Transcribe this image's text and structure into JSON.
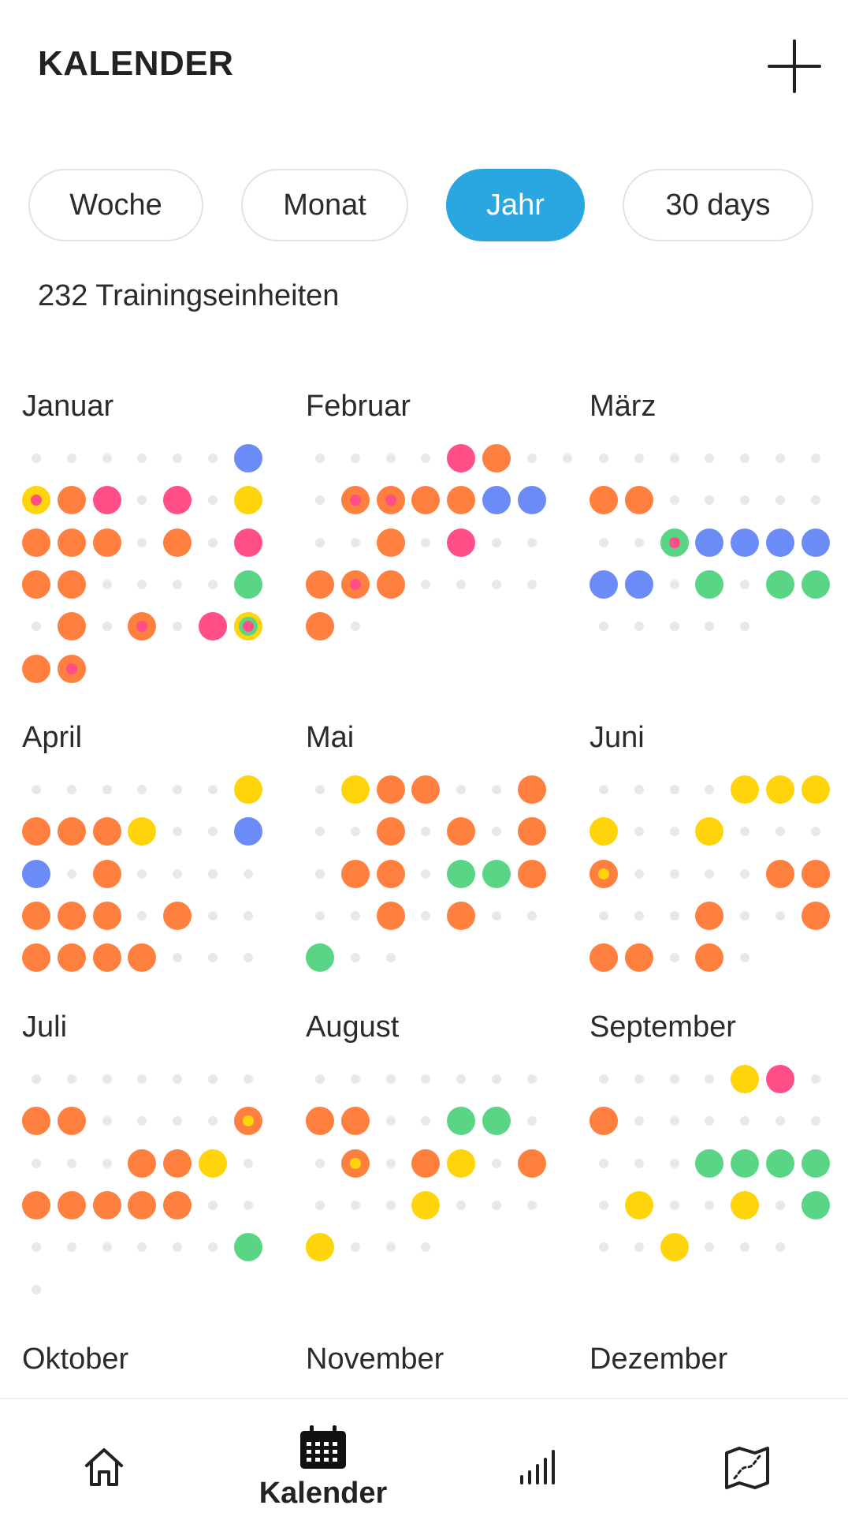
{
  "header": {
    "title": "KALENDER",
    "add_icon": "plus-icon"
  },
  "tabs": [
    {
      "label": "Woche",
      "active": false
    },
    {
      "label": "Monat",
      "active": false
    },
    {
      "label": "Jahr",
      "active": true
    },
    {
      "label": "30 days",
      "active": false
    }
  ],
  "summary": {
    "count_text": "232 Trainingseinheiten"
  },
  "colors": {
    "orange": "#ff7f3f",
    "pink": "#ff4f86",
    "yellow": "#ffd40a",
    "blue": "#6b8cf7",
    "green": "#5ad585",
    "empty": "#e8e8e8",
    "accent": "#2aa6e0"
  },
  "months": [
    {
      "name": "Januar",
      "weeks": [
        [
          ".",
          ".",
          ".",
          ".",
          ".",
          ".",
          "B"
        ],
        [
          "Y/P",
          "O",
          "P",
          ".",
          "P",
          ".",
          "Y"
        ],
        [
          "O",
          "O",
          "O",
          ".",
          "O",
          ".",
          "P"
        ],
        [
          "O",
          "O",
          ".",
          ".",
          ".",
          ".",
          "G"
        ],
        [
          ".",
          "O",
          ".",
          "O/P",
          ".",
          "P",
          "Y/G/P"
        ],
        [
          "O",
          "O/P"
        ]
      ]
    },
    {
      "name": "Februar",
      "weeks": [
        [
          ".",
          ".",
          ".",
          ".",
          "P",
          "O",
          ".",
          "."
        ],
        [
          ".",
          "O/P",
          "O/P",
          "O",
          "O",
          "B",
          "B"
        ],
        [
          ".",
          ".",
          "O",
          ".",
          "P",
          ".",
          "."
        ],
        [
          "O",
          "O/P",
          "O",
          ".",
          ".",
          ".",
          "."
        ],
        [
          "O",
          "."
        ]
      ]
    },
    {
      "name": "März",
      "weeks": [
        [
          ".",
          ".",
          ".",
          ".",
          ".",
          ".",
          "."
        ],
        [
          "O",
          "O",
          ".",
          ".",
          ".",
          ".",
          "."
        ],
        [
          ".",
          ".",
          "G/P",
          "B",
          "B",
          "B",
          "B"
        ],
        [
          "B",
          "B",
          ".",
          "G",
          ".",
          "G",
          "G"
        ],
        [
          ".",
          ".",
          ".",
          ".",
          "."
        ]
      ]
    },
    {
      "name": "April",
      "weeks": [
        [
          ".",
          ".",
          ".",
          ".",
          ".",
          ".",
          "Y"
        ],
        [
          "O",
          "O",
          "O",
          "Y",
          ".",
          ".",
          "B"
        ],
        [
          "B",
          ".",
          "O",
          ".",
          ".",
          ".",
          "."
        ],
        [
          "O",
          "O",
          "O",
          ".",
          "O",
          ".",
          "."
        ],
        [
          "O",
          "O",
          "O",
          "O",
          ".",
          ".",
          "."
        ]
      ]
    },
    {
      "name": "Mai",
      "weeks": [
        [
          ".",
          "Y",
          "O",
          "O",
          ".",
          ".",
          "O"
        ],
        [
          ".",
          ".",
          "O",
          ".",
          "O",
          ".",
          "O"
        ],
        [
          ".",
          "O",
          "O",
          ".",
          "G",
          "G",
          "O"
        ],
        [
          ".",
          ".",
          "O",
          ".",
          "O",
          ".",
          "."
        ],
        [
          "G",
          ".",
          "."
        ]
      ]
    },
    {
      "name": "Juni",
      "weeks": [
        [
          ".",
          ".",
          ".",
          ".",
          "Y",
          "Y",
          "Y"
        ],
        [
          "Y",
          ".",
          ".",
          "Y",
          ".",
          ".",
          "."
        ],
        [
          "O/Y",
          ".",
          ".",
          ".",
          ".",
          "O",
          "O"
        ],
        [
          ".",
          ".",
          ".",
          "O",
          ".",
          ".",
          "O"
        ],
        [
          "O",
          "O",
          ".",
          "O",
          "."
        ]
      ]
    },
    {
      "name": "Juli",
      "weeks": [
        [
          ".",
          ".",
          ".",
          ".",
          ".",
          ".",
          "."
        ],
        [
          "O",
          "O",
          ".",
          ".",
          ".",
          ".",
          "O/Y"
        ],
        [
          ".",
          ".",
          ".",
          "O",
          "O",
          "Y",
          "."
        ],
        [
          "O",
          "O",
          "O",
          "O",
          "O",
          ".",
          "."
        ],
        [
          ".",
          ".",
          ".",
          ".",
          ".",
          ".",
          "G"
        ],
        [
          "."
        ]
      ]
    },
    {
      "name": "August",
      "weeks": [
        [
          ".",
          ".",
          ".",
          ".",
          ".",
          ".",
          "."
        ],
        [
          "O",
          "O",
          ".",
          ".",
          "G",
          "G",
          "."
        ],
        [
          ".",
          "O/Y",
          ".",
          "O",
          "Y",
          ".",
          "O"
        ],
        [
          ".",
          ".",
          ".",
          "Y",
          ".",
          ".",
          "."
        ],
        [
          "Y",
          ".",
          ".",
          "."
        ]
      ]
    },
    {
      "name": "September",
      "weeks": [
        [
          ".",
          ".",
          ".",
          ".",
          "Y",
          "P",
          "."
        ],
        [
          "O",
          ".",
          ".",
          ".",
          ".",
          ".",
          "."
        ],
        [
          ".",
          ".",
          ".",
          "G",
          "G",
          "G",
          "G"
        ],
        [
          ".",
          "Y",
          ".",
          ".",
          "Y",
          ".",
          "G"
        ],
        [
          ".",
          ".",
          "Y",
          ".",
          ".",
          "."
        ]
      ]
    },
    {
      "name": "Oktober",
      "weeks": []
    },
    {
      "name": "November",
      "weeks": []
    },
    {
      "name": "Dezember",
      "weeks": []
    }
  ],
  "nav": {
    "items": [
      {
        "icon": "home-icon"
      },
      {
        "icon": "calendar-icon",
        "label": "Kalender",
        "active": true
      },
      {
        "icon": "stats-icon"
      },
      {
        "icon": "map-icon"
      }
    ]
  }
}
